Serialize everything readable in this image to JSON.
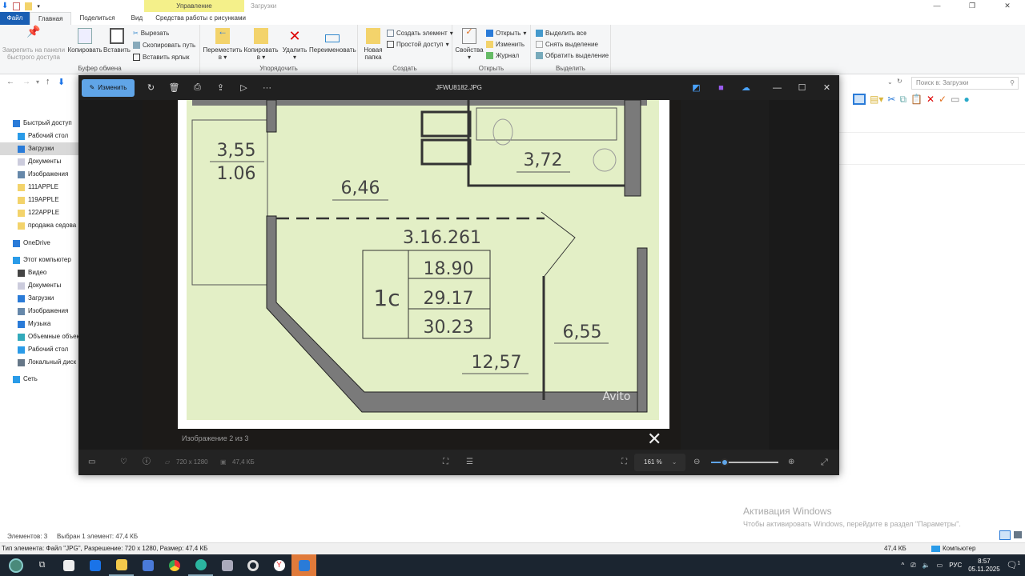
{
  "explorer": {
    "title": "Загрузки",
    "context_tab": "Управление",
    "tabs": [
      "Файл",
      "Главная",
      "Поделиться",
      "Вид",
      "Средства работы с рисунками"
    ],
    "ribbon": {
      "clipboard": {
        "label": "Буфер обмена",
        "pin": "Закрепить на панели быстрого доступа",
        "copy": "Копировать",
        "paste": "Вставить",
        "cut": "Вырезать",
        "copy_path": "Скопировать путь",
        "paste_shortcut": "Вставить ярлык"
      },
      "organize": {
        "label": "Упорядочить",
        "move": "Переместить в",
        "copy_to": "Копировать в",
        "delete": "Удалить",
        "rename": "Переименовать"
      },
      "create": {
        "label": "Создать",
        "new_folder": "Новая папка",
        "new_item": "Создать элемент",
        "easy_access": "Простой доступ"
      },
      "open": {
        "label": "Открыть",
        "properties": "Свойства",
        "open": "Открыть",
        "edit": "Изменить",
        "history": "Журнал"
      },
      "select": {
        "label": "Выделить",
        "all": "Выделить все",
        "none": "Снять выделение",
        "invert": "Обратить выделение"
      }
    },
    "search_placeholder": "Поиск в: Загрузки",
    "nav": [
      {
        "label": "Быстрый доступ",
        "icon": "star-icon"
      },
      {
        "label": "Рабочий стол",
        "icon": "desktop-icon"
      },
      {
        "label": "Загрузки",
        "icon": "download-icon",
        "selected": true
      },
      {
        "label": "Документы",
        "icon": "document-icon"
      },
      {
        "label": "Изображения",
        "icon": "pictures-icon"
      },
      {
        "label": "111APPLE",
        "icon": "folder-icon"
      },
      {
        "label": "119APPLE",
        "icon": "folder-icon"
      },
      {
        "label": "122APPLE",
        "icon": "folder-icon"
      },
      {
        "label": "продажа седова",
        "icon": "folder-icon"
      },
      {
        "label": "OneDrive",
        "icon": "cloud-icon"
      },
      {
        "label": "Этот компьютер",
        "icon": "computer-icon"
      },
      {
        "label": "Видео",
        "icon": "video-icon"
      },
      {
        "label": "Документы",
        "icon": "document-icon"
      },
      {
        "label": "Загрузки",
        "icon": "download-icon"
      },
      {
        "label": "Изображения",
        "icon": "pictures-icon"
      },
      {
        "label": "Музыка",
        "icon": "music-icon"
      },
      {
        "label": "Объемные объекты",
        "icon": "3d-icon"
      },
      {
        "label": "Рабочий стол",
        "icon": "desktop-icon"
      },
      {
        "label": "Локальный диск",
        "icon": "drive-icon"
      },
      {
        "label": "Сеть",
        "icon": "network-icon"
      }
    ],
    "status": {
      "items": "Элементов: 3",
      "selected": "Выбран 1 элемент: 47,4 КБ"
    },
    "details": {
      "text": "Тип элемента: Файл \"JPG\", Разрешение: 720 x 1280, Размер: 47,4 КБ",
      "size": "47,4 КБ",
      "location": "Компьютер"
    }
  },
  "viewer": {
    "edit_label": "Изменить",
    "filename": "JFWU8182.JPG",
    "counter": "Изображение 2 из 3",
    "dimensions": "720 x 1280",
    "filesize": "47,4 КБ",
    "zoom": "161 %",
    "zoom_fraction": 0.2,
    "accent": "#60a5e8",
    "plan": {
      "balcony_area": "3,55",
      "balcony_reduced": "1.06",
      "hall": "6,46",
      "bath": "3,72",
      "apt_number": "3.16.261",
      "type": "1с",
      "living": "18.90",
      "total": "29.17",
      "total_with_balcony": "30.23",
      "room": "12,57",
      "kitchen": "6,55",
      "watermark": "Avito"
    }
  },
  "watermark": {
    "title": "Активация Windows",
    "text": "Чтобы активировать Windows, перейдите в раздел \"Параметры\"."
  },
  "taskbar": {
    "lang": "РУС",
    "time": "8:57",
    "date": "05.11.2025",
    "notifications": "1"
  }
}
